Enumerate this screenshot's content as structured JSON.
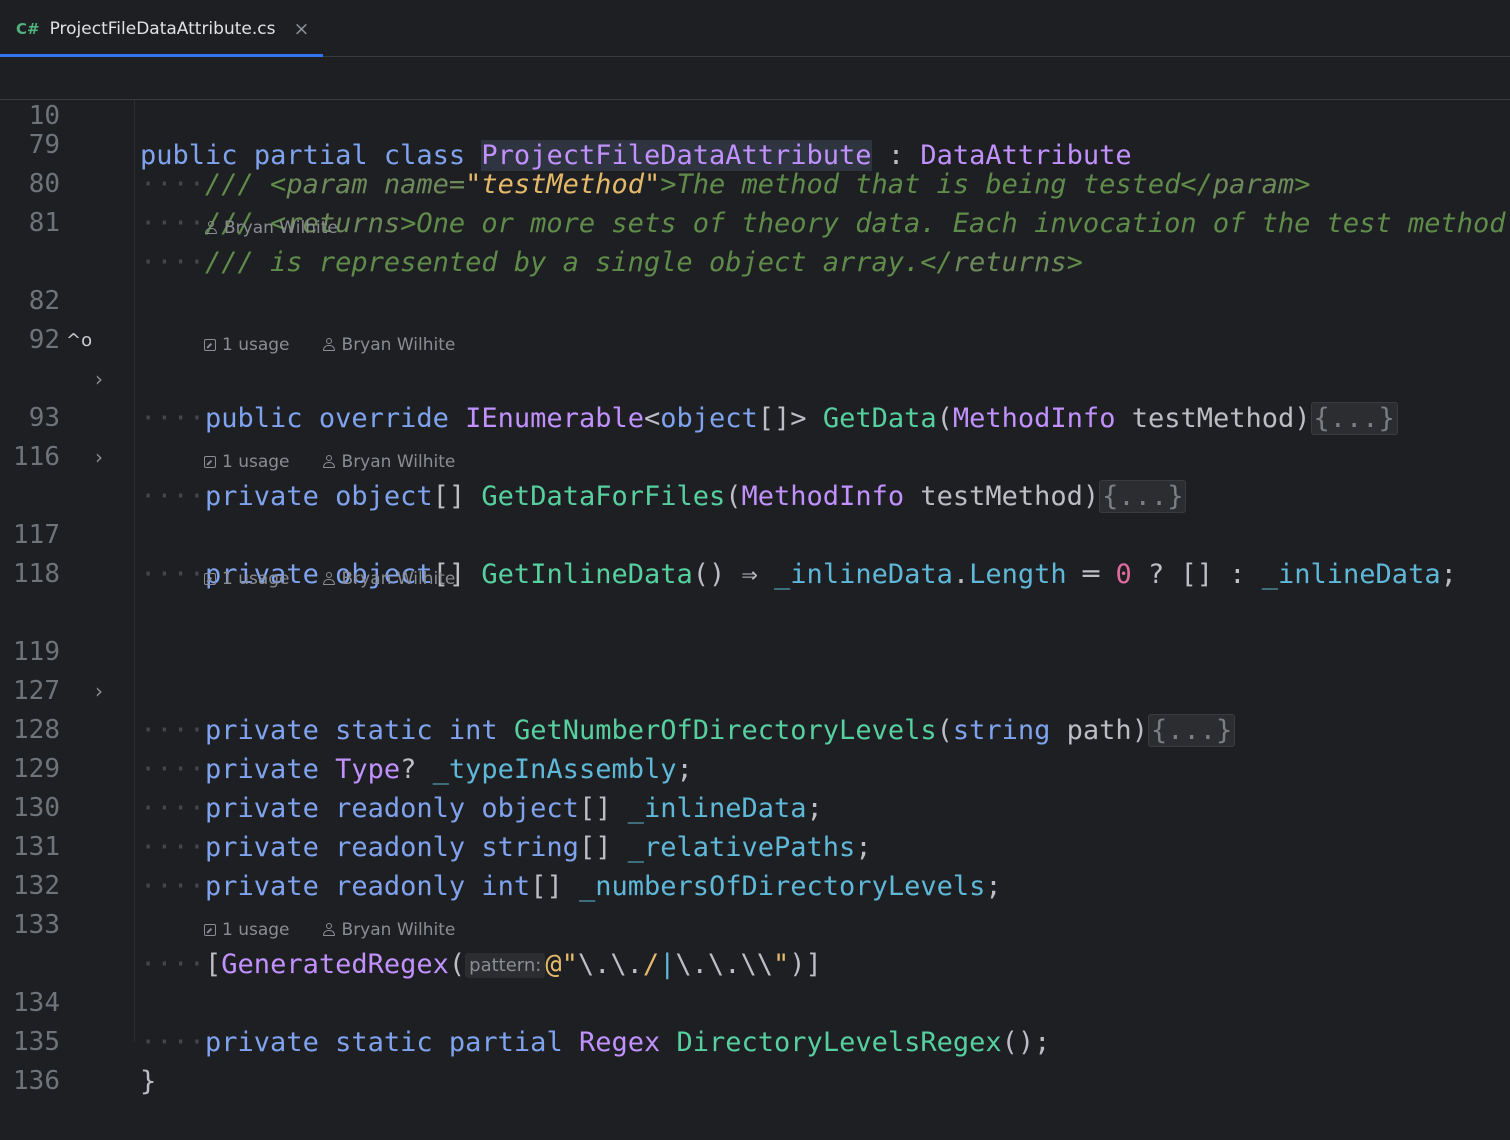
{
  "tab": {
    "lang_badge": "C#",
    "file_name": "ProjectFileDataAttribute.cs",
    "close_glyph": "×"
  },
  "sticky": {
    "line_number": "10",
    "kw_public": "public",
    "kw_partial": "partial",
    "kw_class": "class",
    "class_name": "ProjectFileDataAttribute",
    "colon": " : ",
    "base_class": "DataAttribute"
  },
  "lines": {
    "l79": {
      "num": "79",
      "open": "/// <",
      "tag": "param",
      "attr": " name=",
      "val": "\"testMethod\"",
      "text": ">The method that is being tested</",
      "tag2": "param",
      "close": ">"
    },
    "l80": {
      "num": "80",
      "open": "/// <",
      "tag": "returns",
      "text": ">One or more sets of theory data. Each invocation of the test method"
    },
    "l81": {
      "num": "81",
      "text": "/// is represented by a single object array.</",
      "tag": "returns",
      "close": ">"
    },
    "l82": {
      "num": "82",
      "kw1": "public",
      "kw2": "override",
      "type": "IEnumerable",
      "lt": "<",
      "kw3": "object",
      "arr": "[]>",
      "fn": "GetData",
      "p1": "(",
      "ptype": "MethodInfo",
      "pname": " testMethod",
      "p2": ")",
      "fold": "{...}"
    },
    "l92": {
      "num": "92"
    },
    "l93": {
      "num": "93",
      "kw1": "private",
      "kw2": "object",
      "arr": "[]",
      "fn": "GetDataForFiles",
      "p1": "(",
      "ptype": "MethodInfo",
      "pname": " testMethod",
      "p2": ")",
      "fold": "{...}"
    },
    "l116": {
      "num": "116"
    },
    "l117": {
      "num": "117",
      "kw1": "private",
      "kw2": "object",
      "arr": "[]",
      "fn": "GetInlineData",
      "paren": "()",
      "arrow": " ⇒ ",
      "fld": "_inlineData",
      "dot": ".",
      "prop": "Length",
      "eq": " ═ ",
      "zero": "0",
      "rest1": " ? [] : ",
      "fld2": "_inlineData",
      "semi": ";"
    },
    "l118": {
      "num": "118"
    },
    "l119": {
      "num": "119",
      "kw1": "private",
      "kw2": "static",
      "kw3": "int",
      "fn": "GetNumberOfDirectoryLevels",
      "p1": "(",
      "ptype": "string",
      "pname": " path",
      "p2": ")",
      "fold": "{...}"
    },
    "l127": {
      "num": "127"
    },
    "l128": {
      "num": "128",
      "kw1": "private",
      "type": "Type",
      "q": "? ",
      "fld": "_typeInAssembly",
      "semi": ";"
    },
    "l129": {
      "num": "129",
      "kw1": "private",
      "kw2": "readonly",
      "kw3": "object",
      "arr": "[] ",
      "fld": "_inlineData",
      "semi": ";"
    },
    "l130": {
      "num": "130",
      "kw1": "private",
      "kw2": "readonly",
      "kw3": "string",
      "arr": "[] ",
      "fld": "_relativePaths",
      "semi": ";"
    },
    "l131": {
      "num": "131",
      "kw1": "private",
      "kw2": "readonly",
      "kw3": "int",
      "arr": "[] ",
      "fld": "_numbersOfDirectoryLevels",
      "semi": ";"
    },
    "l132": {
      "num": "132"
    },
    "l133": {
      "num": "133",
      "br1": "[",
      "cls": "GeneratedRegex",
      "p1": "(",
      "hint": "pattern:",
      "at": "@\"",
      "s1": "\\.\\.",
      "s2": "/",
      "pipe": "|",
      "s3": "\\.\\.",
      "s4": "\\\\",
      "q": "\"",
      "end": ")]"
    },
    "l134": {
      "num": "134",
      "kw1": "private",
      "kw2": "static",
      "kw3": "partial",
      "type": "Regex",
      "fn": "DirectoryLevelsRegex",
      "rest": "();"
    },
    "l135": {
      "num": "135",
      "brace": "}"
    },
    "l136": {
      "num": "136"
    }
  },
  "hints": {
    "author": "Bryan Wilhite",
    "usage": "1 usage"
  }
}
